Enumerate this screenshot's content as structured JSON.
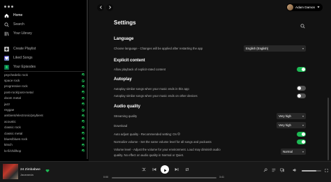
{
  "sidebar": {
    "nav": [
      {
        "label": "Home"
      },
      {
        "label": "Search"
      },
      {
        "label": "Your Library"
      }
    ],
    "actions": [
      {
        "label": "Create Playlist",
        "color": "#b3b3b3"
      },
      {
        "label": "Liked Songs",
        "color": "#5038a0"
      },
      {
        "label": "Your Episodes",
        "color": "#0d6b4d"
      }
    ],
    "playlists": [
      "psychedelic rock",
      "space rock",
      "progressive rock",
      "post-rock/post-metal",
      "doom metal",
      "jazz",
      "reggae",
      "ambient/electronic/psybient",
      "acoustic",
      "classic rock",
      "classic metal",
      "blues/blues rock",
      "kitsch",
      "lo-fi/chillhop"
    ]
  },
  "topbar": {
    "back_icon": "chevron-left-icon",
    "forward_icon": "chevron-right-icon",
    "user_name": "Adam Damon"
  },
  "settings": {
    "title": "Settings",
    "language": {
      "heading": "Language",
      "label": "Choose language - Changes will be applied after restarting the app",
      "value": "English (English)"
    },
    "explicit": {
      "heading": "Explicit content",
      "label": "Allow playback of explicit-rated content",
      "on": true
    },
    "autoplay": {
      "heading": "Autoplay",
      "row1": "Autoplay similar songs when your music ends in this app",
      "row1_on": false,
      "row2": "Autoplay similar songs when your music ends on other devices",
      "row2_on": false
    },
    "audio": {
      "heading": "Audio quality",
      "streaming_label": "Streaming quality",
      "streaming_value": "Very high",
      "download_label": "Download",
      "download_value": "Very high",
      "auto_adjust": "Auto adjust quality - Recommended setting: On",
      "auto_adjust_on": true,
      "normalize": "Normalize volume - Set the same volume level for all songs and podcasts",
      "normalize_on": true,
      "volume_level_line1": "Volume level - Adjust the volume for your environment. Loud may diminish audio",
      "volume_level_line2": "quality. No effect on audio quality in Normal or Quiet.",
      "volume_level_value": "Normal"
    }
  },
  "player": {
    "title": "24 Zimbabwe",
    "artist": "Jacaranda",
    "elapsed": "0:00",
    "duration": "3:41",
    "progress": 0.0,
    "volume": 0.75
  },
  "colors": {
    "accent": "#1db954",
    "background": "#121212",
    "sidebar": "#000000"
  }
}
